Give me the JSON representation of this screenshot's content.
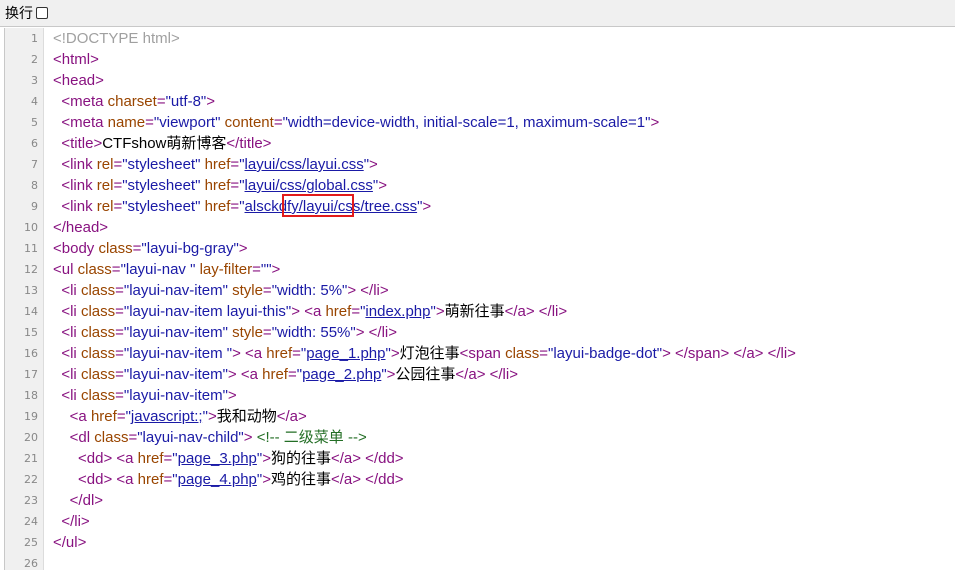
{
  "toolbar": {
    "wrap_label": "换行"
  },
  "colors": {
    "tag": "#881280",
    "attribute": "#994500",
    "value": "#1a1aa6",
    "comment": "#236e25",
    "doctype": "#a0a0a0",
    "annotation_box": "#e21b1b"
  },
  "lines": [
    {
      "n": "1",
      "tokens": [
        {
          "t": "doctype",
          "v": "<!DOCTYPE html>"
        }
      ]
    },
    {
      "n": "2",
      "tokens": [
        {
          "t": "tag",
          "v": "<html>"
        }
      ]
    },
    {
      "n": "3",
      "tokens": [
        {
          "t": "tag",
          "v": "<head>"
        }
      ]
    },
    {
      "n": "4",
      "tokens": [
        {
          "t": "text",
          "v": "  "
        },
        {
          "t": "tag",
          "v": "<meta "
        },
        {
          "t": "attr",
          "v": "charset"
        },
        {
          "t": "tag",
          "v": "="
        },
        {
          "t": "val",
          "v": "\"utf-8\""
        },
        {
          "t": "tag",
          "v": ">"
        }
      ]
    },
    {
      "n": "5",
      "tokens": [
        {
          "t": "text",
          "v": "  "
        },
        {
          "t": "tag",
          "v": "<meta "
        },
        {
          "t": "attr",
          "v": "name"
        },
        {
          "t": "tag",
          "v": "="
        },
        {
          "t": "val",
          "v": "\"viewport\""
        },
        {
          "t": "attr",
          "v": " content"
        },
        {
          "t": "tag",
          "v": "="
        },
        {
          "t": "val",
          "v": "\"width=device-width, initial-scale=1, maximum-scale=1\""
        },
        {
          "t": "tag",
          "v": ">"
        }
      ]
    },
    {
      "n": "6",
      "tokens": [
        {
          "t": "text",
          "v": "  "
        },
        {
          "t": "tag",
          "v": "<title>"
        },
        {
          "t": "text",
          "v": "CTFshow萌新博客"
        },
        {
          "t": "tag",
          "v": "</title>"
        }
      ]
    },
    {
      "n": "7",
      "tokens": [
        {
          "t": "text",
          "v": "  "
        },
        {
          "t": "tag",
          "v": "<link "
        },
        {
          "t": "attr",
          "v": "rel"
        },
        {
          "t": "tag",
          "v": "="
        },
        {
          "t": "val",
          "v": "\"stylesheet\""
        },
        {
          "t": "attr",
          "v": " href"
        },
        {
          "t": "tag",
          "v": "="
        },
        {
          "t": "val",
          "v": "\""
        },
        {
          "t": "link",
          "v": "layui/css/layui.css"
        },
        {
          "t": "val",
          "v": "\""
        },
        {
          "t": "tag",
          "v": ">"
        }
      ]
    },
    {
      "n": "8",
      "tokens": [
        {
          "t": "text",
          "v": "  "
        },
        {
          "t": "tag",
          "v": "<link "
        },
        {
          "t": "attr",
          "v": "rel"
        },
        {
          "t": "tag",
          "v": "="
        },
        {
          "t": "val",
          "v": "\"stylesheet\""
        },
        {
          "t": "attr",
          "v": " href"
        },
        {
          "t": "tag",
          "v": "="
        },
        {
          "t": "val",
          "v": "\""
        },
        {
          "t": "link",
          "v": "layui/css/global.css"
        },
        {
          "t": "val",
          "v": "\""
        },
        {
          "t": "tag",
          "v": ">"
        }
      ]
    },
    {
      "n": "9",
      "tokens": [
        {
          "t": "text",
          "v": "  "
        },
        {
          "t": "tag",
          "v": "<link "
        },
        {
          "t": "attr",
          "v": "rel"
        },
        {
          "t": "tag",
          "v": "="
        },
        {
          "t": "val",
          "v": "\"stylesheet\""
        },
        {
          "t": "attr",
          "v": " href"
        },
        {
          "t": "tag",
          "v": "="
        },
        {
          "t": "val",
          "v": "\""
        },
        {
          "t": "link",
          "v": "alsckdfy/layui/css/tree.css"
        },
        {
          "t": "val",
          "v": "\""
        },
        {
          "t": "tag",
          "v": ">"
        }
      ]
    },
    {
      "n": "10",
      "tokens": [
        {
          "t": "tag",
          "v": "</head>"
        }
      ]
    },
    {
      "n": "11",
      "tokens": [
        {
          "t": "tag",
          "v": "<body "
        },
        {
          "t": "attr",
          "v": "class"
        },
        {
          "t": "tag",
          "v": "="
        },
        {
          "t": "val",
          "v": "\"layui-bg-gray\""
        },
        {
          "t": "tag",
          "v": ">"
        }
      ]
    },
    {
      "n": "12",
      "tokens": [
        {
          "t": "tag",
          "v": "<ul "
        },
        {
          "t": "attr",
          "v": "class"
        },
        {
          "t": "tag",
          "v": "="
        },
        {
          "t": "val",
          "v": "\"layui-nav \""
        },
        {
          "t": "attr",
          "v": " lay-filter"
        },
        {
          "t": "tag",
          "v": "="
        },
        {
          "t": "val",
          "v": "\"\""
        },
        {
          "t": "tag",
          "v": ">"
        }
      ]
    },
    {
      "n": "13",
      "tokens": [
        {
          "t": "text",
          "v": "  "
        },
        {
          "t": "tag",
          "v": "<li "
        },
        {
          "t": "attr",
          "v": "class"
        },
        {
          "t": "tag",
          "v": "="
        },
        {
          "t": "val",
          "v": "\"layui-nav-item\""
        },
        {
          "t": "attr",
          "v": " style"
        },
        {
          "t": "tag",
          "v": "="
        },
        {
          "t": "val",
          "v": "\"width: 5%\""
        },
        {
          "t": "tag",
          "v": "> </li>"
        }
      ]
    },
    {
      "n": "14",
      "tokens": [
        {
          "t": "text",
          "v": "  "
        },
        {
          "t": "tag",
          "v": "<li "
        },
        {
          "t": "attr",
          "v": "class"
        },
        {
          "t": "tag",
          "v": "="
        },
        {
          "t": "val",
          "v": "\"layui-nav-item layui-this\""
        },
        {
          "t": "tag",
          "v": "> <a "
        },
        {
          "t": "attr",
          "v": "href"
        },
        {
          "t": "tag",
          "v": "="
        },
        {
          "t": "val",
          "v": "\""
        },
        {
          "t": "link",
          "v": "index.php"
        },
        {
          "t": "val",
          "v": "\""
        },
        {
          "t": "tag",
          "v": ">"
        },
        {
          "t": "text",
          "v": "萌新往事"
        },
        {
          "t": "tag",
          "v": "</a> </li>"
        }
      ]
    },
    {
      "n": "15",
      "tokens": [
        {
          "t": "text",
          "v": "  "
        },
        {
          "t": "tag",
          "v": "<li "
        },
        {
          "t": "attr",
          "v": "class"
        },
        {
          "t": "tag",
          "v": "="
        },
        {
          "t": "val",
          "v": "\"layui-nav-item\""
        },
        {
          "t": "attr",
          "v": " style"
        },
        {
          "t": "tag",
          "v": "="
        },
        {
          "t": "val",
          "v": "\"width: 55%\""
        },
        {
          "t": "tag",
          "v": "> </li>"
        }
      ]
    },
    {
      "n": "16",
      "tokens": [
        {
          "t": "text",
          "v": "  "
        },
        {
          "t": "tag",
          "v": "<li "
        },
        {
          "t": "attr",
          "v": "class"
        },
        {
          "t": "tag",
          "v": "="
        },
        {
          "t": "val",
          "v": "\"layui-nav-item \""
        },
        {
          "t": "tag",
          "v": "> <a "
        },
        {
          "t": "attr",
          "v": "href"
        },
        {
          "t": "tag",
          "v": "="
        },
        {
          "t": "val",
          "v": "\""
        },
        {
          "t": "link",
          "v": "page_1.php"
        },
        {
          "t": "val",
          "v": "\""
        },
        {
          "t": "tag",
          "v": ">"
        },
        {
          "t": "text",
          "v": "灯泡往事"
        },
        {
          "t": "tag",
          "v": "<span "
        },
        {
          "t": "attr",
          "v": "class"
        },
        {
          "t": "tag",
          "v": "="
        },
        {
          "t": "val",
          "v": "\"layui-badge-dot\""
        },
        {
          "t": "tag",
          "v": "> </span> </a> </li>"
        }
      ]
    },
    {
      "n": "17",
      "tokens": [
        {
          "t": "text",
          "v": "  "
        },
        {
          "t": "tag",
          "v": "<li "
        },
        {
          "t": "attr",
          "v": "class"
        },
        {
          "t": "tag",
          "v": "="
        },
        {
          "t": "val",
          "v": "\"layui-nav-item\""
        },
        {
          "t": "tag",
          "v": "> <a "
        },
        {
          "t": "attr",
          "v": "href"
        },
        {
          "t": "tag",
          "v": "="
        },
        {
          "t": "val",
          "v": "\""
        },
        {
          "t": "link",
          "v": "page_2.php"
        },
        {
          "t": "val",
          "v": "\""
        },
        {
          "t": "tag",
          "v": ">"
        },
        {
          "t": "text",
          "v": "公园往事"
        },
        {
          "t": "tag",
          "v": "</a> </li>"
        }
      ]
    },
    {
      "n": "18",
      "tokens": [
        {
          "t": "text",
          "v": "  "
        },
        {
          "t": "tag",
          "v": "<li "
        },
        {
          "t": "attr",
          "v": "class"
        },
        {
          "t": "tag",
          "v": "="
        },
        {
          "t": "val",
          "v": "\"layui-nav-item\""
        },
        {
          "t": "tag",
          "v": ">"
        }
      ]
    },
    {
      "n": "19",
      "tokens": [
        {
          "t": "text",
          "v": "    "
        },
        {
          "t": "tag",
          "v": "<a "
        },
        {
          "t": "attr",
          "v": "href"
        },
        {
          "t": "tag",
          "v": "="
        },
        {
          "t": "val",
          "v": "\""
        },
        {
          "t": "link",
          "v": "javascript:;"
        },
        {
          "t": "val",
          "v": "\""
        },
        {
          "t": "tag",
          "v": ">"
        },
        {
          "t": "text",
          "v": "我和动物"
        },
        {
          "t": "tag",
          "v": "</a>"
        }
      ]
    },
    {
      "n": "20",
      "tokens": [
        {
          "t": "text",
          "v": "    "
        },
        {
          "t": "tag",
          "v": "<dl "
        },
        {
          "t": "attr",
          "v": "class"
        },
        {
          "t": "tag",
          "v": "="
        },
        {
          "t": "val",
          "v": "\"layui-nav-child\""
        },
        {
          "t": "tag",
          "v": "> "
        },
        {
          "t": "cmt",
          "v": "<!-- 二级菜单 -->"
        }
      ]
    },
    {
      "n": "21",
      "tokens": [
        {
          "t": "text",
          "v": "      "
        },
        {
          "t": "tag",
          "v": "<dd> <a "
        },
        {
          "t": "attr",
          "v": "href"
        },
        {
          "t": "tag",
          "v": "="
        },
        {
          "t": "val",
          "v": "\""
        },
        {
          "t": "link",
          "v": "page_3.php"
        },
        {
          "t": "val",
          "v": "\""
        },
        {
          "t": "tag",
          "v": ">"
        },
        {
          "t": "text",
          "v": "狗的往事"
        },
        {
          "t": "tag",
          "v": "</a> </dd>"
        }
      ]
    },
    {
      "n": "22",
      "tokens": [
        {
          "t": "text",
          "v": "      "
        },
        {
          "t": "tag",
          "v": "<dd> <a "
        },
        {
          "t": "attr",
          "v": "href"
        },
        {
          "t": "tag",
          "v": "="
        },
        {
          "t": "val",
          "v": "\""
        },
        {
          "t": "link",
          "v": "page_4.php"
        },
        {
          "t": "val",
          "v": "\""
        },
        {
          "t": "tag",
          "v": ">"
        },
        {
          "t": "text",
          "v": "鸡的往事"
        },
        {
          "t": "tag",
          "v": "</a> </dd>"
        }
      ]
    },
    {
      "n": "23",
      "tokens": [
        {
          "t": "text",
          "v": "    "
        },
        {
          "t": "tag",
          "v": "</dl>"
        }
      ]
    },
    {
      "n": "24",
      "tokens": [
        {
          "t": "text",
          "v": "  "
        },
        {
          "t": "tag",
          "v": "</li>"
        }
      ]
    },
    {
      "n": "25",
      "tokens": [
        {
          "t": "tag",
          "v": "</ul>"
        }
      ]
    },
    {
      "n": "26",
      "tokens": []
    }
  ]
}
